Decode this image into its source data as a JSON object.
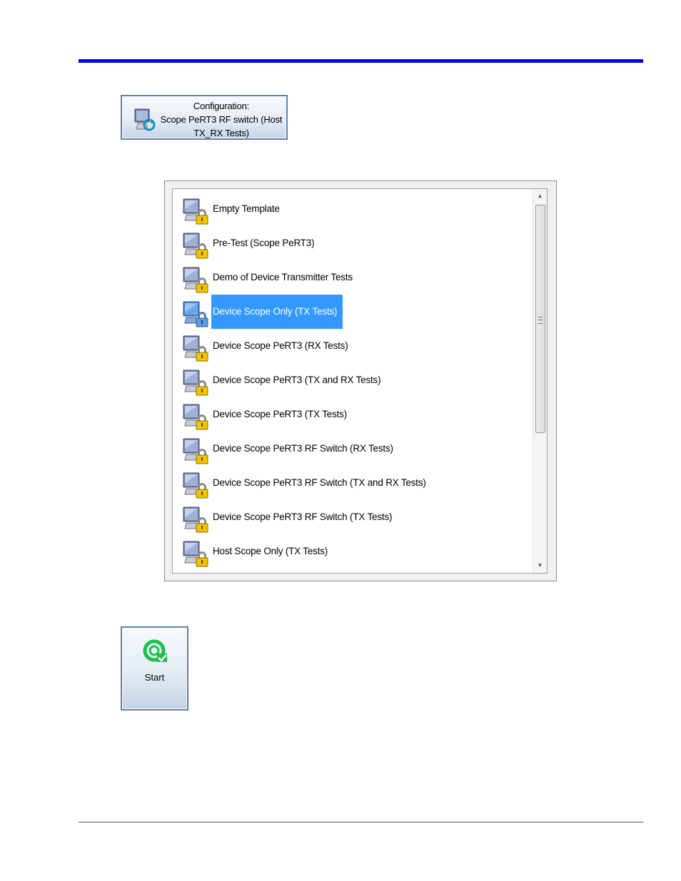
{
  "config_button": {
    "line1": "Configuration:",
    "line2": "Scope PeRT3 RF switch (Host",
    "line3": "TX_RX Tests)",
    "icon": "monitor-refresh-icon"
  },
  "list": {
    "items": [
      {
        "label": "Empty Template",
        "icon": "locked-monitor-icon"
      },
      {
        "label": "Pre-Test (Scope PeRT3)",
        "icon": "locked-monitor-icon"
      },
      {
        "label": "Demo of Device Transmitter Tests",
        "icon": "locked-monitor-icon"
      },
      {
        "label": "Device Scope Only (TX Tests)",
        "icon": "locked-monitor-icon",
        "selected": true
      },
      {
        "label": "Device Scope PeRT3 (RX Tests)",
        "icon": "locked-monitor-icon"
      },
      {
        "label": "Device Scope PeRT3 (TX and RX Tests)",
        "icon": "locked-monitor-icon"
      },
      {
        "label": "Device Scope PeRT3 (TX Tests)",
        "icon": "locked-monitor-icon"
      },
      {
        "label": "Device Scope PeRT3 RF Switch (RX Tests)",
        "icon": "locked-monitor-icon"
      },
      {
        "label": "Device Scope PeRT3 RF Switch (TX and RX Tests)",
        "icon": "locked-monitor-icon"
      },
      {
        "label": "Device Scope PeRT3 RF Switch (TX Tests)",
        "icon": "locked-monitor-icon"
      },
      {
        "label": "Host Scope Only (TX Tests)",
        "icon": "locked-monitor-icon"
      }
    ]
  },
  "start_button": {
    "label": "Start",
    "icon": "start-check-icon"
  },
  "colors": {
    "accent_rule": "#0000e0",
    "selection": "#3399ff",
    "start_icon": "#19c24a"
  }
}
